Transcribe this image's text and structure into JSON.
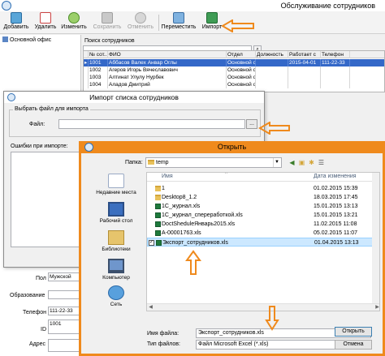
{
  "main_window": {
    "title": "Обслуживание сотрудников",
    "toolbar": {
      "add": "Добавить",
      "delete": "Удалить",
      "edit": "Изменить",
      "save": "Сохранить",
      "cancel": "Отменить",
      "move": "Переместить",
      "import": "Импорт"
    },
    "tree_root": "Основной офис",
    "search_label": "Поиск сотрудников",
    "grid": {
      "columns": [
        "",
        "№ сот...",
        "ФИО",
        "Отдел",
        "Должность",
        "Работает с",
        "Телефон",
        ""
      ],
      "rows": [
        [
          "▸",
          "1001",
          "Аббасов Валех Анвар Оглы",
          "Основной о",
          "",
          "2015-04-01",
          "111-22-33",
          ""
        ],
        [
          "",
          "1002",
          "Агеров Игорь Вячеславович",
          "Основной о",
          "",
          "",
          "",
          ""
        ],
        [
          "",
          "1003",
          "Алтинат Улулу Нурбек",
          "Основной о",
          "",
          "",
          "",
          ""
        ],
        [
          "",
          "1004",
          "Аладов Дмитрий",
          "Основной о",
          "",
          "",
          "",
          ""
        ]
      ]
    },
    "form": {
      "gender_label": "Пол",
      "gender_value": "Мужской",
      "education_label": "Образование",
      "phone_label": "Телефон",
      "phone_value": "111-22-33",
      "id_label": "ID",
      "id_value": "1001",
      "address_label": "Адрес"
    }
  },
  "import_dialog": {
    "title": "Импорт списка сотрудников",
    "group_label": "Выбрать файл для импорта",
    "file_label": "Файл:",
    "file_value": "",
    "browse_label": "...",
    "errors_label": "Ошибки при импорте:"
  },
  "open_dialog": {
    "title": "Открыть",
    "folder_label": "Папка:",
    "folder_value": "temp",
    "places": [
      "Недавние места",
      "Рабочий стол",
      "Библиотеки",
      "Компьютер",
      "Сеть"
    ],
    "columns": {
      "name": "Имя",
      "modified": "Дата изменения"
    },
    "files": [
      {
        "name": "1",
        "date": "01.02.2015 15:39",
        "type": "folder",
        "selected": false
      },
      {
        "name": "Desktop8_1.2",
        "date": "18.03.2015 17:45",
        "type": "folder",
        "selected": false
      },
      {
        "name": "1С_журнал.xls",
        "date": "15.01.2015 13:13",
        "type": "xls",
        "selected": false
      },
      {
        "name": "1С_журнал_сперерaботкой.xls",
        "date": "15.01.2015 13:21",
        "type": "xls",
        "selected": false
      },
      {
        "name": "DoctSheduleЯнварь2015.xls",
        "date": "11.02.2015 11:08",
        "type": "xls",
        "selected": false
      },
      {
        "name": "A-00001763.xls",
        "date": "05.02.2015 11:07",
        "type": "xls",
        "selected": false
      },
      {
        "name": "Экспорт_сотрудников.xls",
        "date": "01.04.2015 13:13",
        "type": "xls",
        "selected": true
      }
    ],
    "filename_label": "Имя файла:",
    "filename_value": "Экспорт_сотрудников.xls",
    "filetype_label": "Тип файлов:",
    "filetype_value": "Файл Microsoft Excel (*.xls)",
    "open_button": "Открыть",
    "cancel_button": "Отмена"
  },
  "colors": {
    "highlight_orange": "#ef8a1d",
    "selection_blue": "#3468c8",
    "list_selection": "#cce8ff"
  }
}
